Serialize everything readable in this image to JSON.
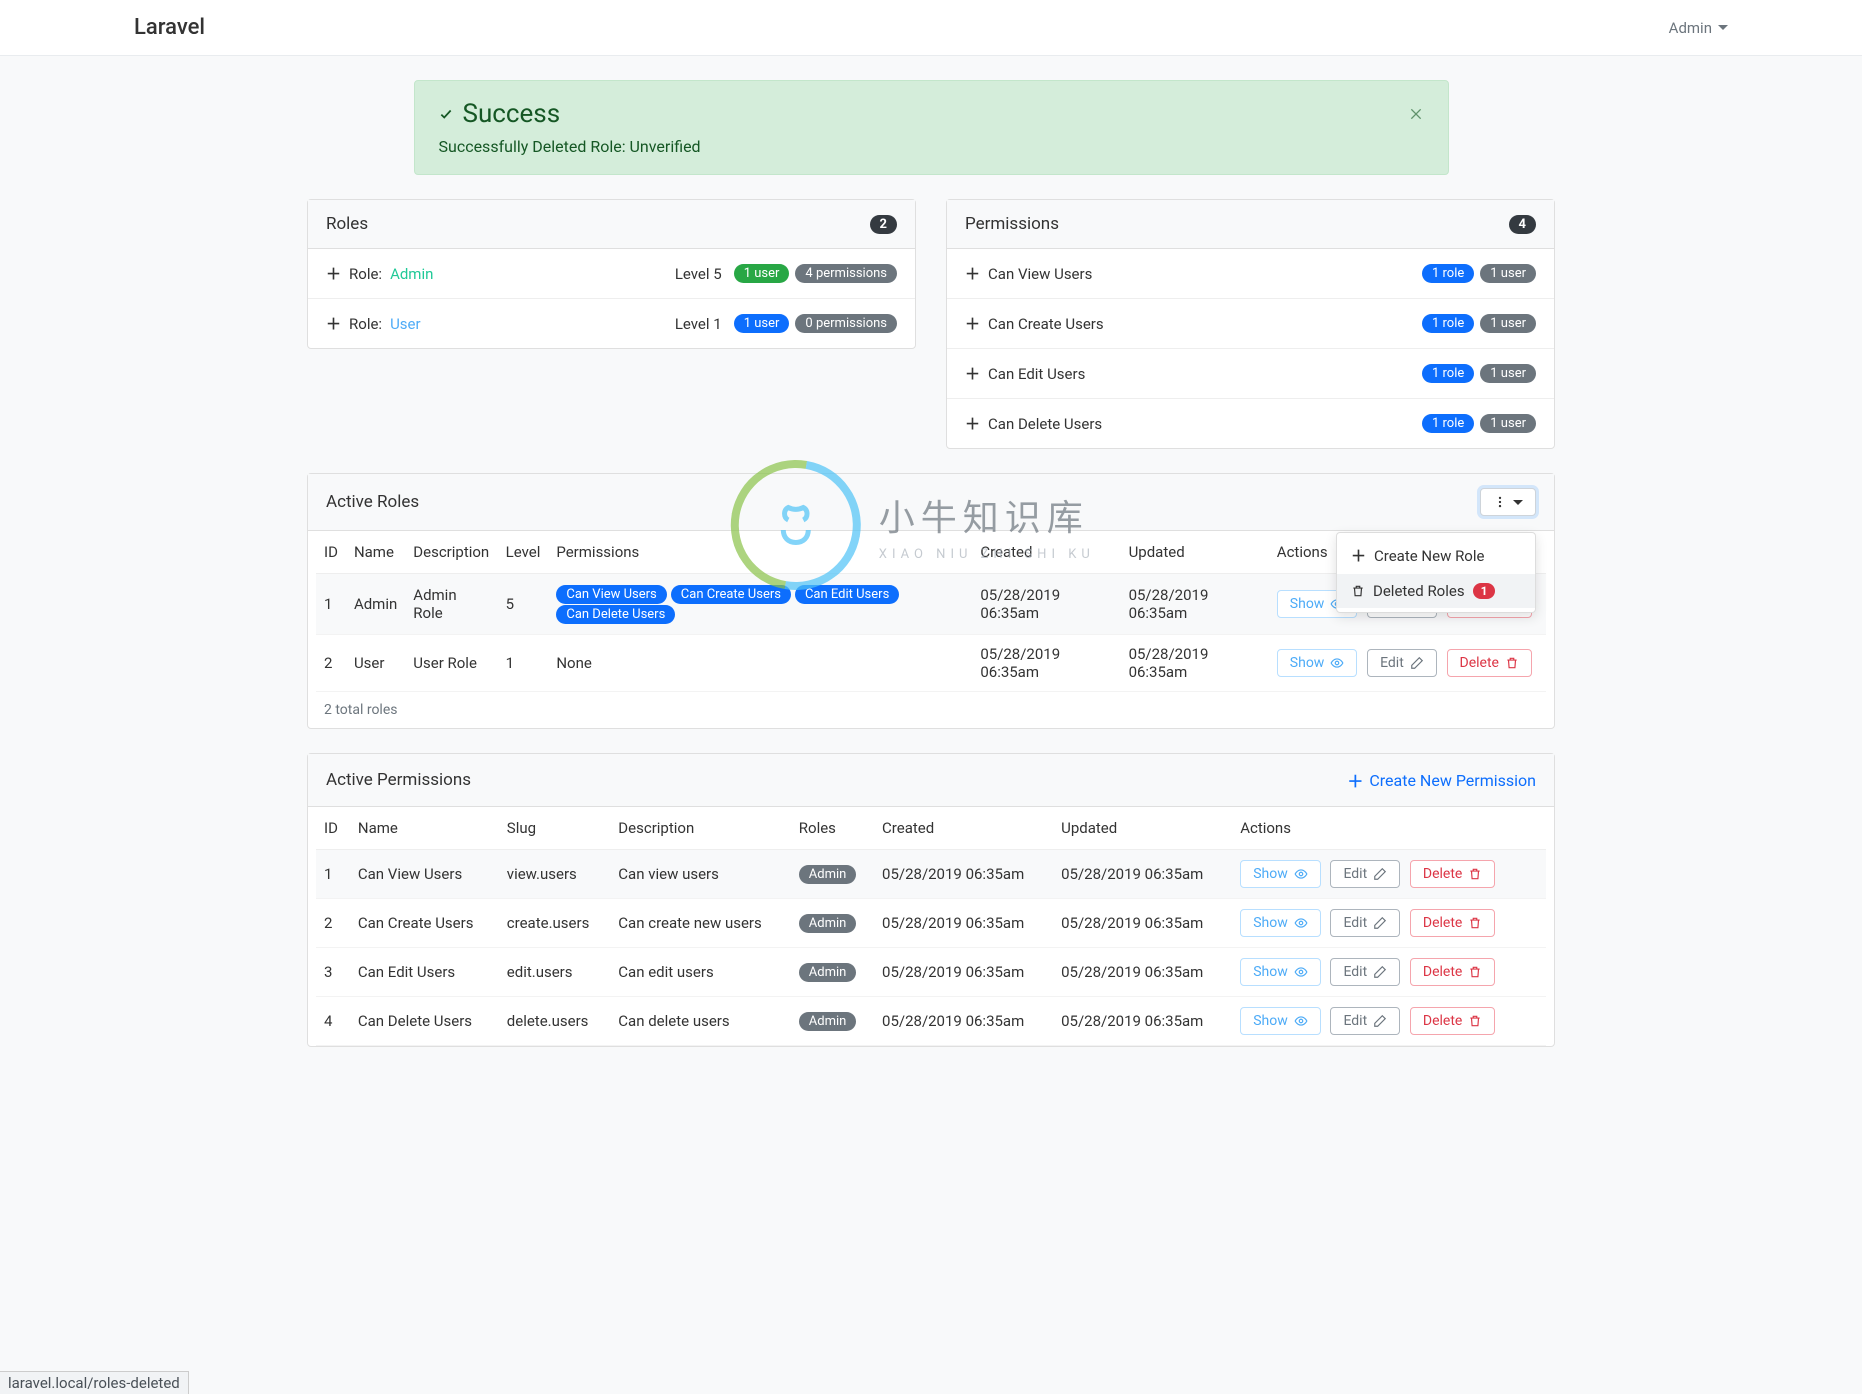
{
  "navbar": {
    "brand": "Laravel",
    "user": "Admin"
  },
  "alert": {
    "title": "Success",
    "message": "Successfully Deleted Role: Unverified"
  },
  "roles_card": {
    "title": "Roles",
    "count": "2",
    "items": [
      {
        "prefix": "Role:",
        "name": "Admin",
        "level": "Level 5",
        "users": "1 user",
        "perms": "4 permissions",
        "user_color": "green"
      },
      {
        "prefix": "Role:",
        "name": "User",
        "level": "Level 1",
        "users": "1 user",
        "perms": "0 permissions",
        "user_color": "blue"
      }
    ]
  },
  "perms_card": {
    "title": "Permissions",
    "count": "4",
    "items": [
      {
        "name": "Can View Users",
        "roles": "1 role",
        "users": "1 user"
      },
      {
        "name": "Can Create Users",
        "roles": "1 role",
        "users": "1 user"
      },
      {
        "name": "Can Edit Users",
        "roles": "1 role",
        "users": "1 user"
      },
      {
        "name": "Can Delete Users",
        "roles": "1 role",
        "users": "1 user"
      }
    ]
  },
  "active_roles": {
    "title": "Active Roles",
    "columns": [
      "ID",
      "Name",
      "Description",
      "Level",
      "Permissions",
      "Created",
      "Updated",
      "Actions"
    ],
    "rows": [
      {
        "id": "1",
        "name": "Admin",
        "desc": "Admin Role",
        "level": "5",
        "perms": [
          "Can View Users",
          "Can Create Users",
          "Can Edit Users",
          "Can Delete Users"
        ],
        "created": "05/28/2019 06:35am",
        "updated": "05/28/2019 06:35am"
      },
      {
        "id": "2",
        "name": "User",
        "desc": "User Role",
        "level": "1",
        "perms_text": "None",
        "created": "05/28/2019 06:35am",
        "updated": "05/28/2019 06:35am"
      }
    ],
    "footer": "2 total roles",
    "dropdown": {
      "create": "Create New Role",
      "deleted": "Deleted Roles",
      "deleted_count": "1"
    }
  },
  "active_perms": {
    "title": "Active Permissions",
    "create_link": "Create New Permission",
    "columns": [
      "ID",
      "Name",
      "Slug",
      "Description",
      "Roles",
      "Created",
      "Updated",
      "Actions"
    ],
    "rows": [
      {
        "id": "1",
        "name": "Can View Users",
        "slug": "view.users",
        "desc": "Can view users",
        "role": "Admin",
        "created": "05/28/2019 06:35am",
        "updated": "05/28/2019 06:35am"
      },
      {
        "id": "2",
        "name": "Can Create Users",
        "slug": "create.users",
        "desc": "Can create new users",
        "role": "Admin",
        "created": "05/28/2019 06:35am",
        "updated": "05/28/2019 06:35am"
      },
      {
        "id": "3",
        "name": "Can Edit Users",
        "slug": "edit.users",
        "desc": "Can edit users",
        "role": "Admin",
        "created": "05/28/2019 06:35am",
        "updated": "05/28/2019 06:35am"
      },
      {
        "id": "4",
        "name": "Can Delete Users",
        "slug": "delete.users",
        "desc": "Can delete users",
        "role": "Admin",
        "created": "05/28/2019 06:35am",
        "updated": "05/28/2019 06:35am"
      }
    ]
  },
  "actions": {
    "show": "Show",
    "edit": "Edit",
    "delete": "Delete"
  },
  "watermark": {
    "cn": "小牛知识库",
    "en": "XIAO NIU ZHI SHI KU"
  },
  "status_url": "laravel.local/roles-deleted"
}
